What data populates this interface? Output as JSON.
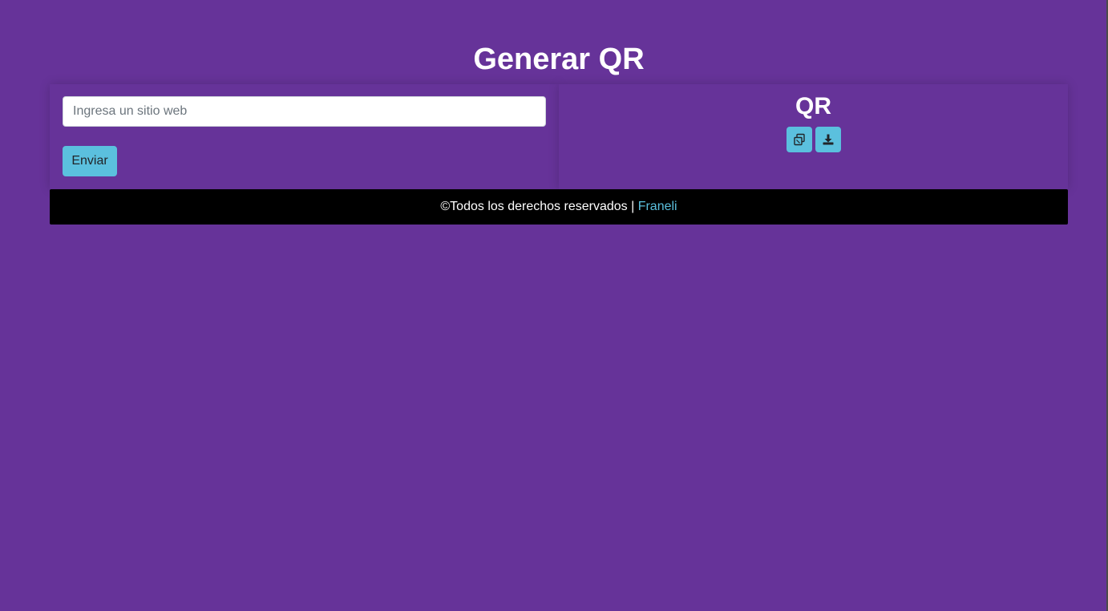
{
  "header": {
    "title": "Generar QR"
  },
  "form": {
    "url_placeholder": "Ingresa un sitio web",
    "url_value": "",
    "submit_label": "Enviar"
  },
  "qr_panel": {
    "heading": "QR",
    "copy_icon": "copy-icon",
    "download_icon": "download-icon"
  },
  "footer": {
    "text": "©Todos los derechos reservados |",
    "link_label": "Franeli"
  },
  "colors": {
    "background": "#663399",
    "accent": "#5bc0de",
    "footer_background": "#000000",
    "text": "#ffffff"
  }
}
